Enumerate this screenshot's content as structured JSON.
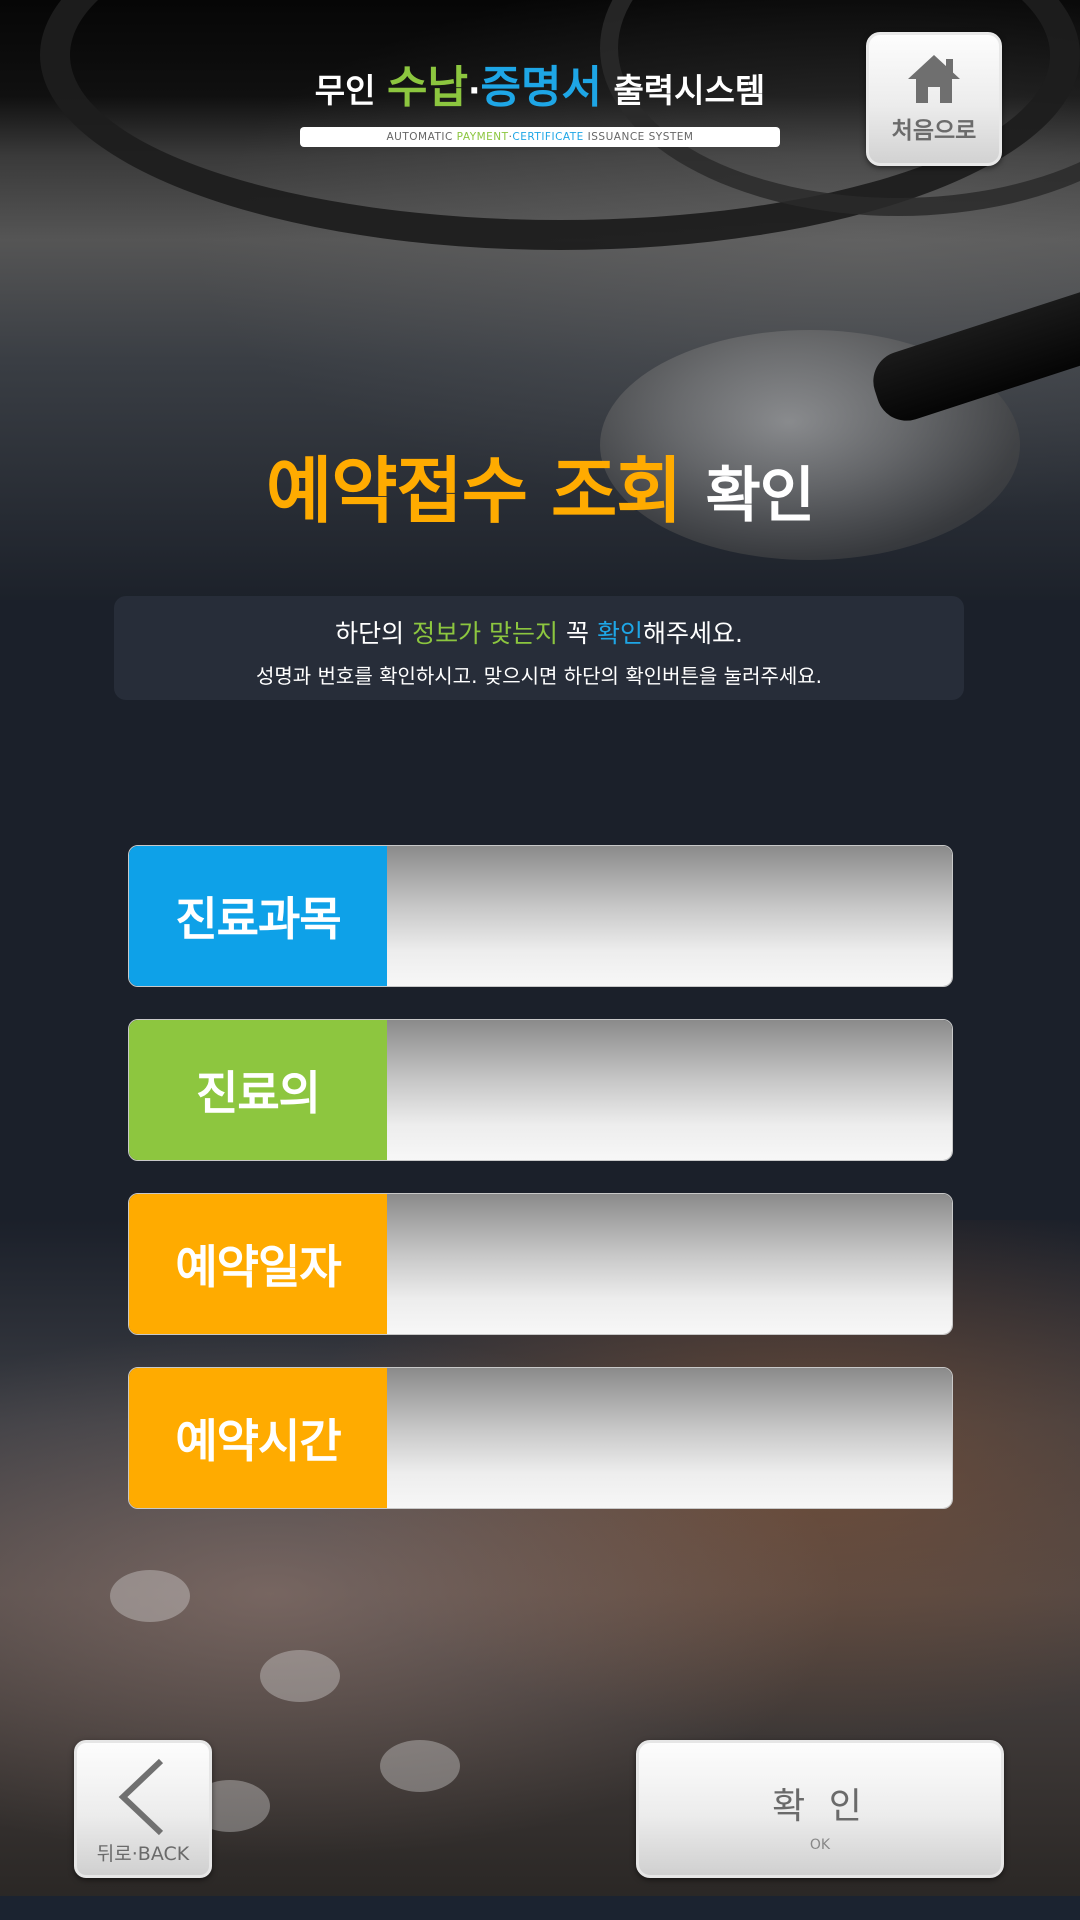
{
  "header": {
    "logo_prefix": "무인",
    "logo_green": "수납",
    "logo_dot": "·",
    "logo_blue": "증명서",
    "logo_suffix": "출력시스템",
    "tagline_a": "AUTOMATIC",
    "tagline_green": "PAYMENT",
    "tagline_dot": "·",
    "tagline_blue": "CERTIFICATE",
    "tagline_b": "ISSUANCE SYSTEM",
    "home_label": "처음으로"
  },
  "page": {
    "title_orange": "예약접수 조회",
    "title_white": "확인"
  },
  "notice": {
    "l1_a": "하단의",
    "l1_green": "정보가 맞는지",
    "l1_b": "꼭",
    "l1_blue": "확인",
    "l1_c": "해주세요.",
    "line2": "성명과 번호를 확인하시고. 맞으시면 하단의 확인버튼을 눌러주세요."
  },
  "fields": [
    {
      "label": "진료과목",
      "value": "",
      "color": "#0ea1e8"
    },
    {
      "label": "진료의",
      "value": "",
      "color": "#8dc63f"
    },
    {
      "label": "예약일자",
      "value": "",
      "color": "#ffab00"
    },
    {
      "label": "예약시간",
      "value": "",
      "color": "#ffab00"
    }
  ],
  "footer": {
    "back_label": "뒤로·BACK",
    "ok_label": "확 인",
    "ok_sub": "OK"
  },
  "colors": {
    "green": "#8cc63f",
    "blue": "#1ea6e6",
    "orange": "#ffab00"
  },
  "icons": {
    "home": "home-icon",
    "back": "chevron-left-icon"
  }
}
